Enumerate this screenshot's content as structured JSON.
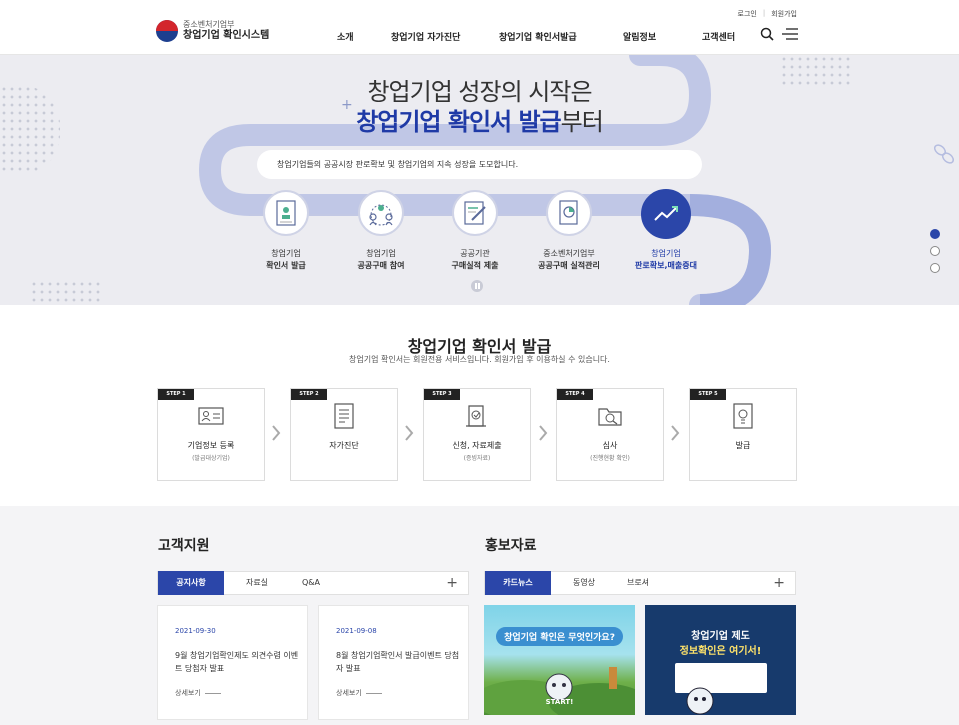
{
  "header": {
    "logo_small": "중소벤처기업부",
    "logo_big": "창업기업 확인시스템",
    "util_login": "로그인",
    "util_join": "회원가입",
    "nav": [
      "소개",
      "창업기업 자가진단",
      "창업기업 확인서발급",
      "알림정보",
      "고객센터"
    ]
  },
  "hero": {
    "title_line1": "창업기업 성장의 시작은",
    "title_line2_bold": "창업기업 확인서 발급",
    "title_line2_rest": "부터",
    "bubble": "창업기업들의 공공시장 판로확보 및 창업기업의 지속 성장을 도모합니다.",
    "steps": [
      {
        "line1": "창업기업",
        "line2": "확인서 발급",
        "icon": "certificate-icon"
      },
      {
        "line1": "창업기업",
        "line2": "공공구매 참여",
        "icon": "people-icon"
      },
      {
        "line1": "공공기관",
        "line2": "구매실적 제출",
        "icon": "document-pen-icon"
      },
      {
        "line1": "중소벤처기업부",
        "line2": "공공구매 실적관리",
        "icon": "document-chart-icon"
      },
      {
        "line1": "창업기업",
        "line2": "판로확보,매출증대",
        "icon": "growth-chart-icon"
      }
    ]
  },
  "issue": {
    "title": "창업기업 확인서 발급",
    "subtitle": "창업기업 확인서는 회원전용 서비스입니다. 회원가입 후 이용하실 수 있습니다.",
    "steps": [
      {
        "tag": "STEP 1",
        "name": "기업정보 등록",
        "desc": "(발급대상기업)",
        "icon": "id-card-icon"
      },
      {
        "tag": "STEP 2",
        "name": "자가진단",
        "desc": "",
        "icon": "checklist-icon"
      },
      {
        "tag": "STEP 3",
        "name": "신청, 자료제출",
        "desc": "(증빙자료)",
        "icon": "document-check-icon"
      },
      {
        "tag": "STEP 4",
        "name": "심사",
        "desc": "(진행현황 확인)",
        "icon": "folder-search-icon"
      },
      {
        "tag": "STEP 5",
        "name": "발급",
        "desc": "",
        "icon": "lightbulb-icon"
      }
    ]
  },
  "support": {
    "title": "고객지원",
    "tabs": [
      "공지사항",
      "자료실",
      "Q&A"
    ],
    "notices": [
      {
        "date": "2021-09-30",
        "title": "9월 창업기업확인제도 의견수렴 이벤트 당첨자 발표",
        "more": "상세보기"
      },
      {
        "date": "2021-09-08",
        "title": "8월 창업기업확인서 발급이벤트 당첨자 발표",
        "more": "상세보기"
      }
    ]
  },
  "promotion": {
    "title": "홍보자료",
    "tabs": [
      "카드뉴스",
      "동영상",
      "브로셔"
    ],
    "card1_text": "창업기업 확인은 무엇인가요?",
    "card1_start": "START!",
    "card2_title": "창업기업 제도",
    "card2_sub": "정보확인은 여기서!"
  }
}
